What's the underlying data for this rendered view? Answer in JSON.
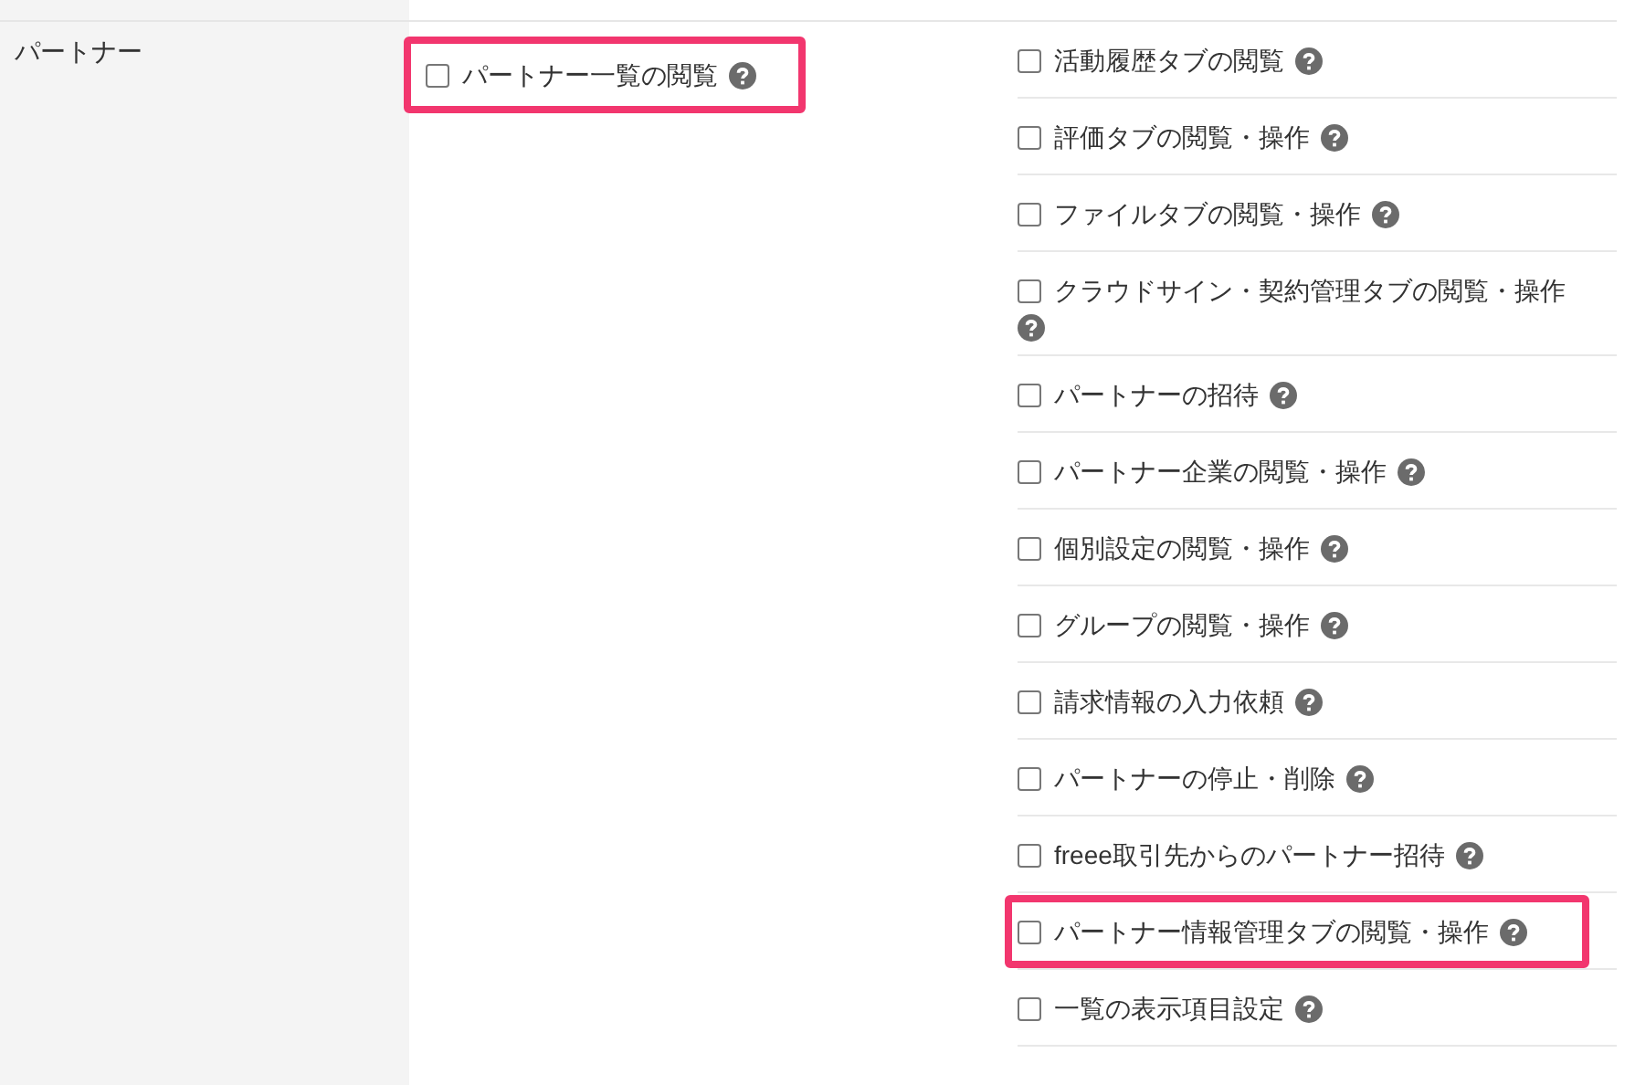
{
  "section": {
    "label": "パートナー",
    "primary": [
      {
        "label": "パートナー一覧の閲覧",
        "checked": false,
        "highlighted": true
      }
    ],
    "options": [
      {
        "label": "活動履歴タブの閲覧",
        "checked": false,
        "highlighted": false
      },
      {
        "label": "評価タブの閲覧・操作",
        "checked": false,
        "highlighted": false
      },
      {
        "label": "ファイルタブの閲覧・操作",
        "checked": false,
        "highlighted": false
      },
      {
        "label": "クラウドサイン・契約管理タブの閲覧・操作",
        "checked": false,
        "highlighted": false
      },
      {
        "label": "パートナーの招待",
        "checked": false,
        "highlighted": false
      },
      {
        "label": "パートナー企業の閲覧・操作",
        "checked": false,
        "highlighted": false
      },
      {
        "label": "個別設定の閲覧・操作",
        "checked": false,
        "highlighted": false
      },
      {
        "label": "グループの閲覧・操作",
        "checked": false,
        "highlighted": false
      },
      {
        "label": "請求情報の入力依頼",
        "checked": false,
        "highlighted": false
      },
      {
        "label": "パートナーの停止・削除",
        "checked": false,
        "highlighted": false
      },
      {
        "label": "freee取引先からのパートナー招待",
        "checked": false,
        "highlighted": false
      },
      {
        "label": "パートナー情報管理タブの閲覧・操作",
        "checked": false,
        "highlighted": true
      },
      {
        "label": "一覧の表示項目設定",
        "checked": false,
        "highlighted": false
      }
    ]
  }
}
